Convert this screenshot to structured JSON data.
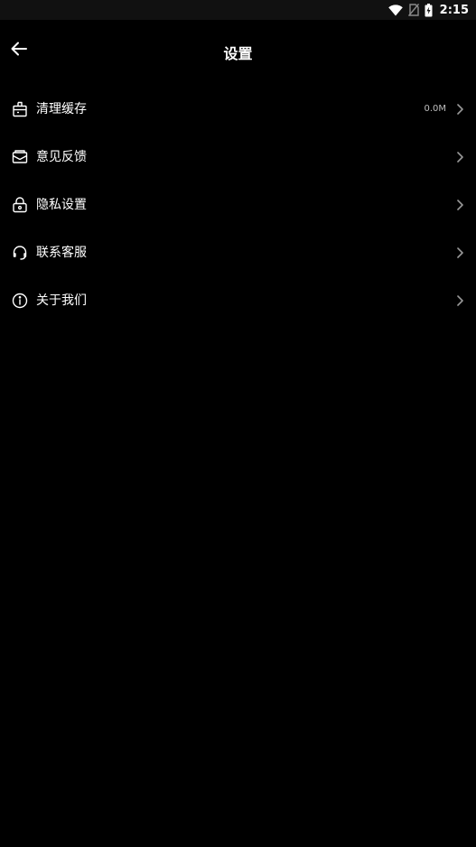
{
  "status_bar": {
    "time": "2:15",
    "icons": [
      "wifi-icon",
      "no-sim-icon",
      "battery-charging-icon"
    ]
  },
  "header": {
    "title": "设置",
    "back_icon": "arrow-left-icon"
  },
  "menu": {
    "items": [
      {
        "label": "清理缓存",
        "icon": "clean-cache-icon",
        "value": "0.0M"
      },
      {
        "label": "意见反馈",
        "icon": "feedback-mail-icon"
      },
      {
        "label": "隐私设置",
        "icon": "lock-icon"
      },
      {
        "label": "联系客服",
        "icon": "headset-icon"
      },
      {
        "label": "关于我们",
        "icon": "info-icon"
      }
    ],
    "chevron_icon": "chevron-right-icon"
  },
  "colors": {
    "background": "#000000",
    "text": "#ffffff",
    "secondary_text": "#bdbdbd",
    "chevron": "#9a9a9a"
  }
}
